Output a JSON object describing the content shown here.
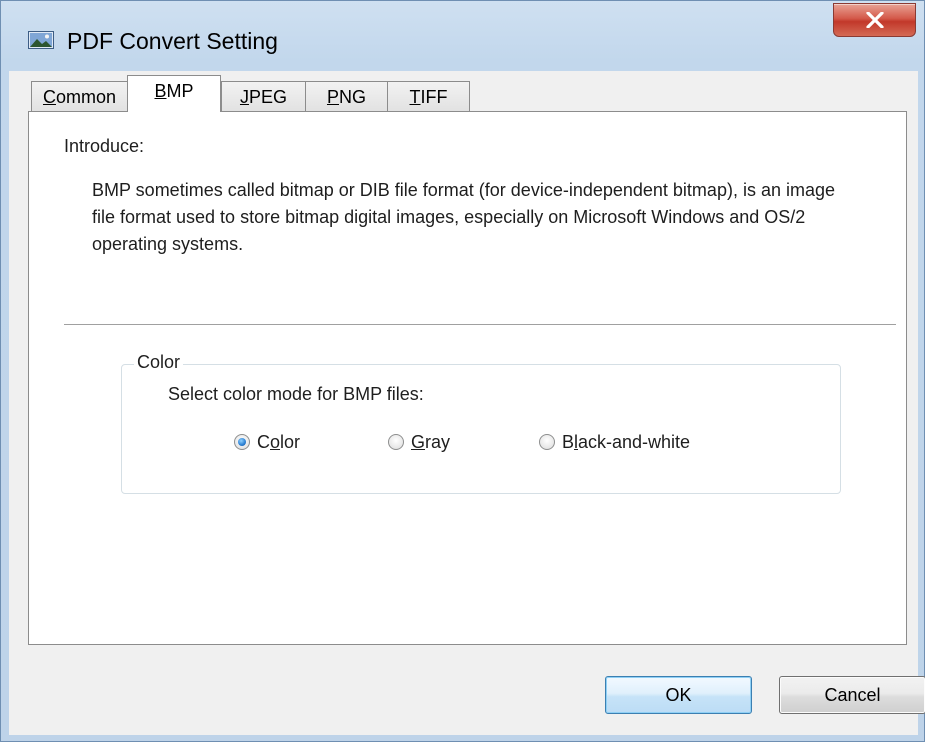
{
  "window": {
    "title": "PDF Convert Setting"
  },
  "tabs": [
    {
      "label": "Common",
      "ul": "C",
      "rest": "ommon"
    },
    {
      "label": "BMP",
      "ul": "B",
      "rest": "MP"
    },
    {
      "label": "JPEG",
      "ul": "J",
      "rest": "PEG"
    },
    {
      "label": "PNG",
      "ul": "P",
      "rest": "NG"
    },
    {
      "label": "TIFF",
      "ul": "T",
      "rest": "IFF"
    }
  ],
  "active_tab": "BMP",
  "introduce": {
    "label": "Introduce:",
    "body": "BMP sometimes called bitmap or DIB file format (for device-independent bitmap), is an image file format used to store bitmap digital images, especially on Microsoft Windows and OS/2 operating systems."
  },
  "color_group": {
    "legend": "Color",
    "description": "Select color mode for BMP files:",
    "options": [
      {
        "label": "Color",
        "pre": "C",
        "ul": "o",
        "post": "lor",
        "selected": true
      },
      {
        "label": "Gray",
        "pre": "",
        "ul": "G",
        "post": "ray",
        "selected": false
      },
      {
        "label": "Black-and-white",
        "pre": "B",
        "ul": "l",
        "post": "ack-and-white",
        "selected": false
      }
    ]
  },
  "buttons": {
    "ok": "OK",
    "cancel": "Cancel"
  },
  "icons": {
    "app": "image-window-icon",
    "close": "close-x-icon"
  }
}
